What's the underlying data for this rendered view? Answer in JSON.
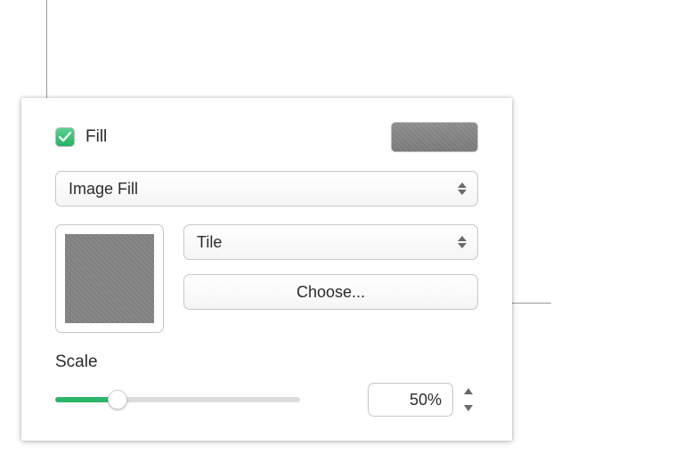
{
  "fill": {
    "checkbox_checked": true,
    "label": "Fill",
    "type": "Image Fill",
    "tile_mode": "Tile",
    "choose_label": "Choose...",
    "preview_color": "#7f7f7f"
  },
  "scale": {
    "label": "Scale",
    "value_text": "50%",
    "value": 50
  }
}
